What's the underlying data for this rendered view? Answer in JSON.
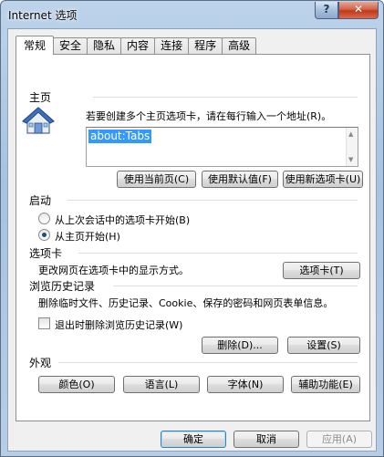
{
  "window": {
    "title": "Internet 选项",
    "help_label": "?",
    "close_label": "✕"
  },
  "tabs": [
    {
      "label": "常规",
      "active": true
    },
    {
      "label": "安全"
    },
    {
      "label": "隐私"
    },
    {
      "label": "内容"
    },
    {
      "label": "连接"
    },
    {
      "label": "程序"
    },
    {
      "label": "高级"
    }
  ],
  "home": {
    "title": "主页",
    "instruction": "若要创建多个主页选项卡，请在每行输入一个地址(R)。",
    "url_value": "about:Tabs",
    "btn_current": "使用当前页(C)",
    "btn_default": "使用默认值(F)",
    "btn_newtab": "使用新选项卡(U)"
  },
  "startup": {
    "title": "启动",
    "option_last": "从上次会话中的选项卡开始(B)",
    "option_home": "从主页开始(H)",
    "selected": "option_home"
  },
  "tabs_section": {
    "title": "选项卡",
    "description": "更改网页在选项卡中的显示方式。",
    "button": "选项卡(T)"
  },
  "history": {
    "title": "浏览历史记录",
    "description": "删除临时文件、历史记录、Cookie、保存的密码和网页表单信息。",
    "checkbox_label": "退出时删除浏览历史记录(W)",
    "checkbox_checked": false,
    "btn_delete": "删除(D)...",
    "btn_settings": "设置(S)"
  },
  "appearance": {
    "title": "外观",
    "btn_colors": "颜色(O)",
    "btn_languages": "语言(L)",
    "btn_fonts": "字体(N)",
    "btn_accessibility": "辅助功能(E)"
  },
  "footer": {
    "ok": "确定",
    "cancel": "取消",
    "apply": "应用(A)"
  }
}
